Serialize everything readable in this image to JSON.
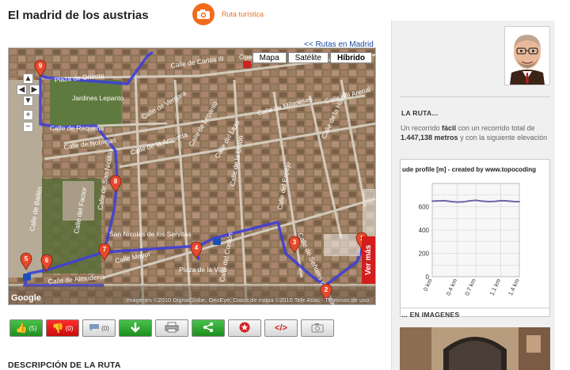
{
  "header": {
    "title": "El madrid de los austrias",
    "route_type": "Ruta turística",
    "back_link": "<< Rutas en Madrid"
  },
  "map": {
    "types": [
      "Mapa",
      "Satélite",
      "Híbrido"
    ],
    "active_type": "Híbrido",
    "ver_mas": "Ver más",
    "copyright": "Imágenes ©2010 DigitalGlobe, GeoEye, Datos de mapa ©2010 Tele Atlas - Términos de uso",
    "logo": "Google",
    "opera": "Ópera",
    "streets": [
      "Calle de Carlos III",
      "Plaza de Oriente",
      "Jardines Lepanto",
      "Calle de Requena",
      "Calle de Noblejas",
      "Calle de Bailén",
      "Calle de Vergara",
      "Calle de la Amnistía",
      "Calle de Lepanto",
      "Calle del Lazo",
      "Calle de la Unión",
      "Calle del Espejo",
      "Calle de Milaneses",
      "Calle de la Hileta",
      "Calle del Arenal",
      "Calle Mayor",
      "Calle de Señores de Luzón",
      "Plaza de la Villa",
      "Calle del Cordón",
      "Calle de San Nicolás",
      "San Nicolás de los Servitas",
      "Calle del Factor",
      "Calle de Almudena"
    ],
    "markers": [
      "1",
      "2",
      "3",
      "4",
      "5",
      "6",
      "7",
      "8",
      "9"
    ]
  },
  "toolbar": {
    "like_count": "(5)",
    "dislike_count": "(0)",
    "comment_count": "(0)"
  },
  "description_heading": "DESCRIPCIÓN DE LA RUTA",
  "sidebar": {
    "ruta_heading": "LA RUTA...",
    "ruta_text_1": "Un recorrido ",
    "ruta_difficulty": "fácil",
    "ruta_text_2": " con un recorrido total de ",
    "ruta_distance": "1.447,138 metros",
    "ruta_text_3": " y con la siguiente elevación",
    "images_heading": "... EN IMAGENES"
  },
  "chart_data": {
    "type": "line",
    "title": "ude profile [m] - created by www.topocoding",
    "x": [
      0,
      0.1,
      0.2,
      0.3,
      0.4,
      0.5,
      0.6,
      0.7,
      0.8,
      0.9,
      1.0,
      1.1,
      1.2,
      1.3,
      1.4
    ],
    "series": [
      {
        "values": [
          648,
          650,
          652,
          645,
          640,
          642,
          650,
          655,
          648,
          644,
          646,
          652,
          650,
          645,
          643
        ]
      }
    ],
    "xtick_labels": [
      "0 km",
      "0.4 km",
      "0.7 km",
      "1.1 km",
      "1.4 km"
    ],
    "xtick_values": [
      0,
      0.4,
      0.7,
      1.1,
      1.4
    ],
    "ytick_labels": [
      "0",
      "200",
      "400",
      "600"
    ],
    "ytick_values": [
      0,
      200,
      400,
      600
    ],
    "ylim": [
      0,
      800
    ],
    "xlim": [
      0,
      1.4
    ],
    "grid": true,
    "line_color": "#6a66a8"
  },
  "colors": {
    "accent": "#f26b1d",
    "route_line": "#3f3fd6",
    "marker": "#e8492c",
    "green_button": "#2aa82c",
    "red_button": "#e51414"
  }
}
